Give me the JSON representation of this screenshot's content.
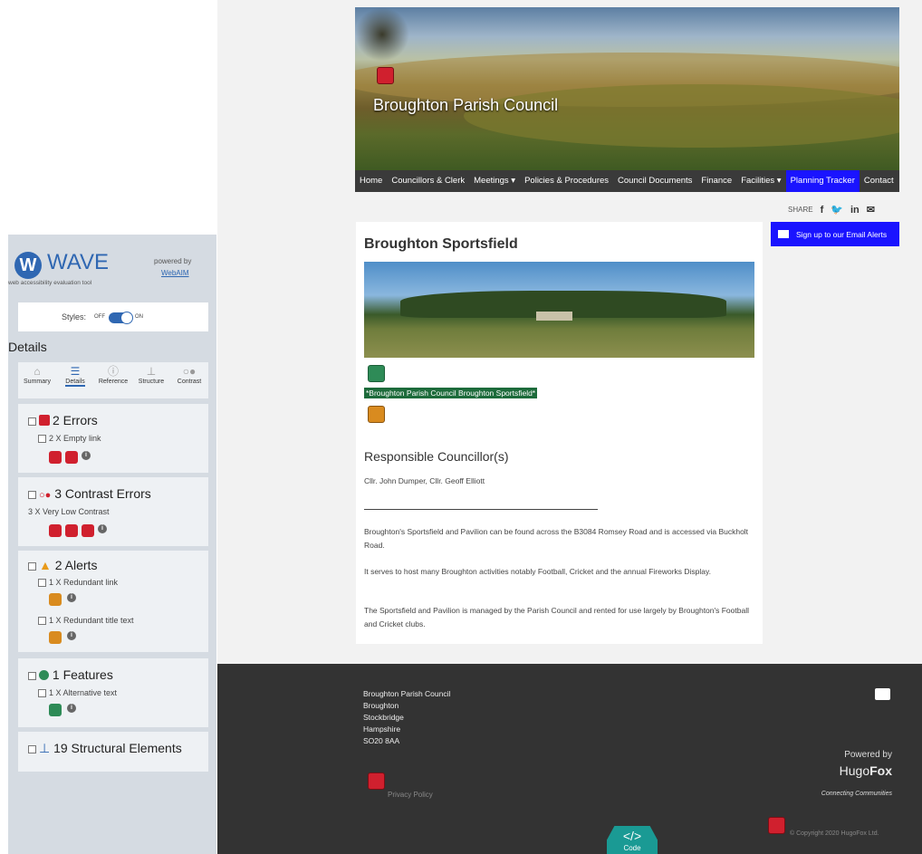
{
  "site": {
    "title": "Broughton Parish Council",
    "nav": [
      "Home",
      "Councillors & Clerk",
      "Meetings ▾",
      "Policies & Procedures",
      "Council Documents",
      "Finance",
      "Facilities ▾",
      "Planning Tracker",
      "Contact"
    ],
    "active_nav": "Planning Tracker",
    "share_label": "SHARE",
    "share_icons": [
      "facebook-icon",
      "twitter-icon",
      "linkedin-icon",
      "mail-icon"
    ],
    "email_alert_button": "Sign up to our Email Alerts"
  },
  "page": {
    "heading": "Broughton Sportsfield",
    "image_alt_text": "*Broughton Parish Council Broughton Sportsfield*",
    "subheading": "Responsible Councillor(s)",
    "councillors": "Cllr. John Dumper, Cllr. Geoff Elliott",
    "paragraphs": [
      "Broughton's Sportsfield and Pavilion can be found across the B3084 Romsey Road and is accessed via Buckholt Road.",
      "It serves to host many Broughton activities notably Football, Cricket and the annual Fireworks Display.",
      "The Sportsfield and Pavilion is managed by the Parish Council and rented for use largely by Broughton's Football and Cricket clubs."
    ]
  },
  "footer": {
    "address": [
      "Broughton Parish Council",
      "Broughton",
      "Stockbridge",
      "Hampshire",
      "SO20 8AA"
    ],
    "privacy": "Privacy Policy",
    "powered_by": "Powered by",
    "brand_light": "Hugo",
    "brand_bold": "Fox",
    "tagline": "Connecting Communities",
    "copyright": "© Copyright 2020 HugoFox Ltd.",
    "code_button": "Code"
  },
  "wave": {
    "logo_letter": "W",
    "logo_text": "WAVE",
    "subtitle": "web accessibility evaluation tool",
    "powered_by": "powered by",
    "webaim": "WebAIM",
    "styles_label": "Styles:",
    "off": "OFF",
    "on": "ON",
    "details_title": "Details",
    "tabs": [
      "Summary",
      "Details",
      "Reference",
      "Structure",
      "Contrast"
    ],
    "active_tab": "Details",
    "errors": {
      "title": "2 Errors",
      "sub": "2 X Empty link"
    },
    "contrast": {
      "title": "3 Contrast Errors",
      "sub": "3 X Very Low Contrast"
    },
    "alerts": {
      "title": "2 Alerts",
      "sub1": "1 X Redundant link",
      "sub2": "1 X Redundant title text"
    },
    "features": {
      "title": "1 Features",
      "sub": "1 X Alternative text"
    },
    "structure": {
      "title": "19 Structural Elements"
    }
  },
  "colors": {
    "accent_blue": "#1a14ff",
    "wave_blue": "#2f67b2",
    "error_red": "#d0202e",
    "alert_orange": "#d98b1f",
    "feature_green": "#2e8b57"
  }
}
